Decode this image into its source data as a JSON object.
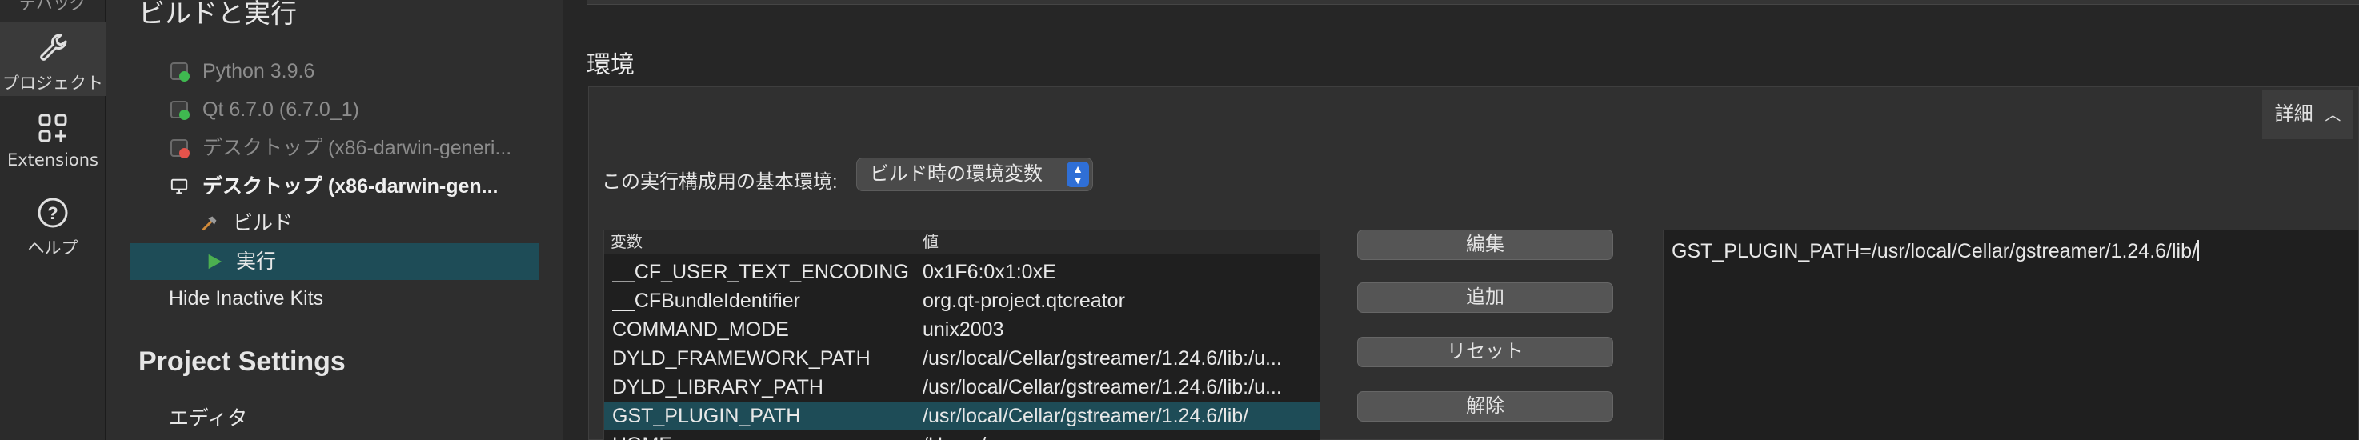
{
  "modebar": {
    "prev_label": "デバッグ",
    "project_label": "プロジェクト",
    "extensions_label": "Extensions",
    "help_label": "ヘルプ"
  },
  "tree": {
    "build_section_title": "ビルドと実行",
    "kits": [
      {
        "label": "Python 3.9.6"
      },
      {
        "label": "Qt 6.7.0 (6.7.0_1)"
      },
      {
        "label": "デスクトップ (x86-darwin-generi..."
      },
      {
        "label": "デスクトップ (x86-darwin-gen..."
      }
    ],
    "build_item": "ビルド",
    "run_item": "実行",
    "hide_inactive": "Hide Inactive Kits",
    "project_settings_title": "Project Settings",
    "editor_item": "エディタ"
  },
  "main": {
    "env_title": "環境",
    "details_label": "詳細",
    "base_env_label": "この実行構成用の基本環境:",
    "base_env_value": "ビルド時の環境変数",
    "table": {
      "col_variable": "変数",
      "col_value": "値",
      "rows": [
        {
          "name": "__CF_USER_TEXT_ENCODING",
          "value": "0x1F6:0x1:0xE"
        },
        {
          "name": "__CFBundleIdentifier",
          "value": "org.qt-project.qtcreator"
        },
        {
          "name": "COMMAND_MODE",
          "value": "unix2003"
        },
        {
          "name": "DYLD_FRAMEWORK_PATH",
          "value": "/usr/local/Cellar/gstreamer/1.24.6/lib:/u..."
        },
        {
          "name": "DYLD_LIBRARY_PATH",
          "value": "/usr/local/Cellar/gstreamer/1.24.6/lib:/u..."
        },
        {
          "name": "GST_PLUGIN_PATH",
          "value": "/usr/local/Cellar/gstreamer/1.24.6/lib/"
        },
        {
          "name": "HOME",
          "value": "/Users/..."
        }
      ]
    },
    "buttons": {
      "edit": "編集",
      "add": "追加",
      "reset": "リセット",
      "unset": "解除"
    },
    "editor_text": "GST_PLUGIN_PATH=/usr/local/Cellar/gstreamer/1.24.6/lib/"
  },
  "colors": {
    "selection": "#1e4c57",
    "accent_blue": "#2f6fd6",
    "kit_ok": "#3fb950",
    "kit_error": "#e5534b",
    "run_green": "#4caf50",
    "hammer": "#d08a3a"
  }
}
